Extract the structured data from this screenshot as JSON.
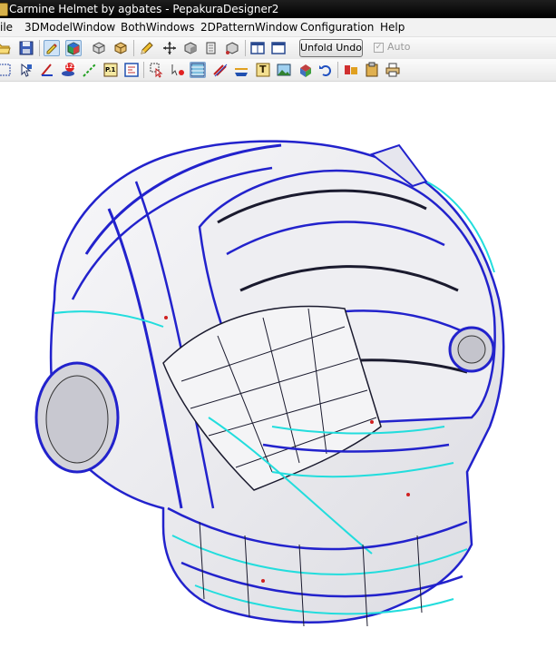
{
  "window": {
    "title": "Carmine Helmet by agbates - PepakuraDesigner2"
  },
  "menu": {
    "items": [
      "ile",
      "3DModelWindow",
      "BothWindows",
      "2DPatternWindow",
      "Configuration",
      "Help"
    ]
  },
  "toolbar1": {
    "unfold_undo_label": "Unfold Undo",
    "auto_label": "Auto",
    "auto_checked": true
  },
  "toolbar2": {
    "badge_label": "123",
    "page_icon_label": "P.1",
    "text_icon_label": "T"
  },
  "colors": {
    "title_bar": "#000000",
    "menu_bg": "#f2f2f2",
    "fold_edge_blue": "#2a2ad6",
    "cut_edge_cyan": "#22e0e0",
    "mesh_line": "#1a1a2e",
    "surface": "#f0f0f4"
  },
  "icons": [
    "open-folder-icon",
    "save-icon",
    "edit-tool-icon",
    "color-cube-icon",
    "view-box-icon",
    "view-box-2-icon",
    "pencil-icon",
    "move-icon",
    "cube-icon",
    "box-grid-icon",
    "window-icon",
    "single-window-icon",
    "select-icon",
    "cursor-icon",
    "number-badge-icon",
    "rotate-icon",
    "dashed-line-icon",
    "page-icon",
    "frame-icon",
    "select-arrow-icon",
    "arrow-edge-icon",
    "texture-icon",
    "stripes-icon",
    "flap-icon",
    "text-icon",
    "image-icon",
    "paint-icon",
    "undo-icon",
    "print-setup-icon",
    "clipboard-icon",
    "printer-icon"
  ]
}
